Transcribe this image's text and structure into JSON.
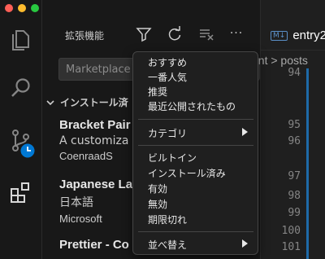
{
  "window": {
    "traffic_colors": [
      "#ff5f57",
      "#febc2e",
      "#28c840"
    ]
  },
  "activity_bar": {
    "items": [
      "explorer-icon",
      "search-icon",
      "source-control-icon",
      "extensions-icon"
    ],
    "accent": "#0078d4"
  },
  "sidebar": {
    "title": "拡張機能",
    "toolbar": [
      "filter-icon",
      "refresh-icon",
      "clear-icon",
      "more-icon"
    ],
    "more_label": "···",
    "search_placeholder": "Marketplace",
    "section_title": "インストール済",
    "extensions": [
      {
        "name": "Bracket Pair",
        "desc": "A customiza",
        "author": "CoenraadS"
      },
      {
        "name": "Japanese La",
        "desc": "日本語",
        "author": "Microsoft"
      },
      {
        "name": "Prettier - Co",
        "desc": "",
        "author": ""
      }
    ]
  },
  "editor": {
    "tab_badge": "M↓",
    "tab_label": "entry2",
    "breadcrumb": "ent > posts",
    "line_numbers": [
      "94",
      "95",
      "96",
      "97",
      "98",
      "99",
      "100",
      "101"
    ]
  },
  "menu": {
    "group1": [
      "おすすめ",
      "一番人気",
      "推奨",
      "最近公開されたもの"
    ],
    "category": "カテゴリ",
    "group3": [
      "ビルトイン",
      "インストール済み",
      "有効",
      "無効",
      "期限切れ"
    ],
    "sort": "並べ替え"
  }
}
